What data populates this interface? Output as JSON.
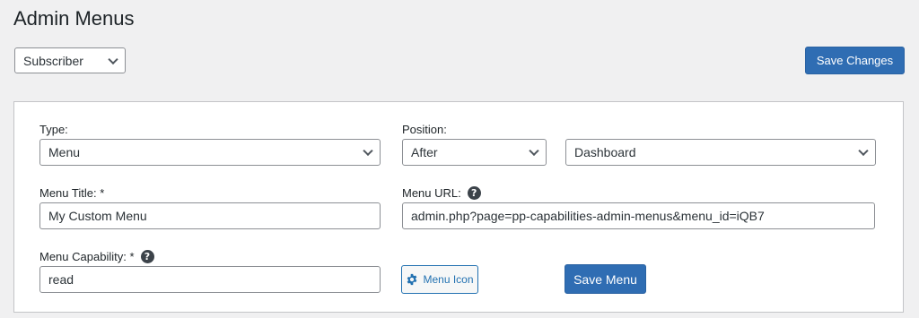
{
  "page": {
    "title": "Admin Menus"
  },
  "toolbar": {
    "role_select": "Subscriber",
    "save_changes_label": "Save Changes"
  },
  "form": {
    "type": {
      "label": "Type:",
      "value": "Menu"
    },
    "position": {
      "label": "Position:",
      "value": "After",
      "target_value": "Dashboard"
    },
    "menu_title": {
      "label": "Menu Title: *",
      "value": "My Custom Menu"
    },
    "menu_url": {
      "label": "Menu URL:",
      "value": "admin.php?page=pp-capabilities-admin-menus&menu_id=iQB7"
    },
    "menu_capability": {
      "label": "Menu Capability: *",
      "value": "read"
    },
    "menu_icon_label": "Menu Icon",
    "save_menu_label": "Save Menu",
    "help_glyph": "?"
  },
  "colors": {
    "background": "#f0f0f1",
    "primary": "#2f6db3",
    "link": "#2271b1"
  },
  "icons": [
    "chevron-down-icon",
    "help-icon",
    "gear-icon"
  ]
}
